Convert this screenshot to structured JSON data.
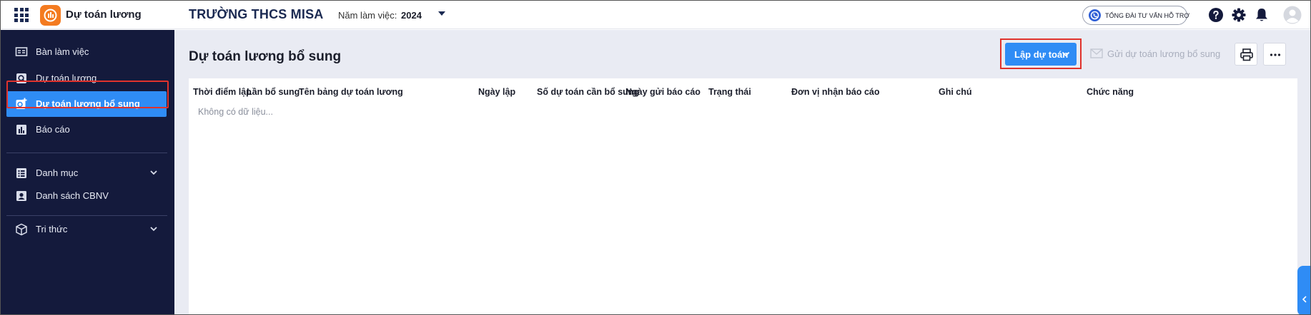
{
  "header": {
    "app_name": "Dự toán lương",
    "school_name": "TRƯỜNG THCS MISA",
    "year_label": "Năm làm việc:",
    "year_value": "2024",
    "support_label": "TỔNG ĐÀI TƯ VẤN HỖ TRỢ",
    "icons": [
      "apps-grid-icon",
      "app-logo-icon",
      "help-icon",
      "gear-icon",
      "bell-icon",
      "avatar-icon"
    ]
  },
  "sidebar": {
    "items": [
      {
        "label": "Bàn làm việc",
        "icon": "desk-icon"
      },
      {
        "label": "Dự toán lương",
        "icon": "salary-icon"
      },
      {
        "label": "Dự toán lương bổ sung",
        "icon": "salary-plus-icon",
        "active": true
      },
      {
        "label": "Báo cáo",
        "icon": "report-icon"
      },
      {
        "label": "Danh mục",
        "icon": "list-icon",
        "expandable": true
      },
      {
        "label": "Danh sách CBNV",
        "icon": "staff-icon"
      },
      {
        "label": "Tri thức",
        "icon": "cube-icon",
        "expandable": true
      }
    ]
  },
  "main": {
    "title": "Dự toán lương bổ sung",
    "create_button": "Lập dự toán",
    "send_button": "Gửi dự toán lương bổ sung",
    "table": {
      "columns": [
        "Thời điểm lập",
        "Lần bổ sung",
        "Tên bảng dự toán lương",
        "Ngày lập",
        "Số dự toán cần bổ sung",
        "Ngày gửi báo cáo",
        "Trạng thái",
        "Đơn vị nhận báo cáo",
        "Ghi chú",
        "Chức năng"
      ],
      "empty_text": "Không có dữ liệu..."
    }
  },
  "colors": {
    "sidebar_bg": "#141a3c",
    "accent": "#2f8cf5",
    "highlight_outline": "#e0322c",
    "logo": "#f47b20"
  }
}
